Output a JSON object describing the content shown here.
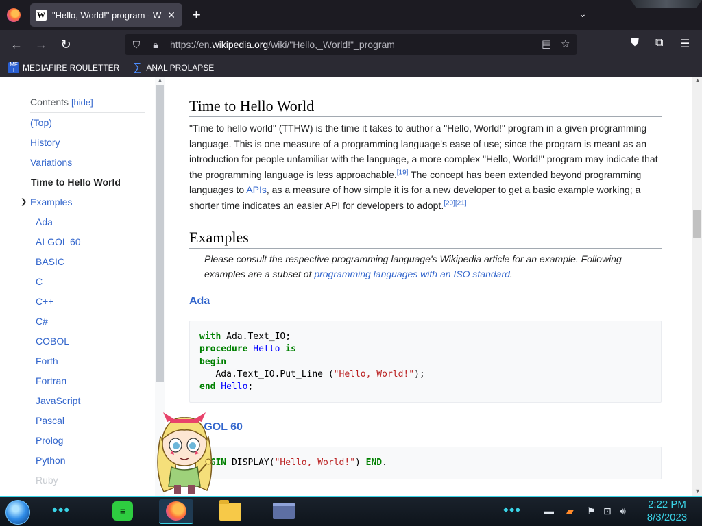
{
  "browser": {
    "tab_title": "\"Hello, World!\" program - Wikip",
    "tab_favicon": "W",
    "new_tab": "+",
    "url_prefix": "https://en.",
    "url_domain": "wikipedia.org",
    "url_path": "/wiki/\"Hello,_World!\"_program"
  },
  "bookmarks": [
    {
      "label": "MEDIAFIRE ROULETTER",
      "icon": "mediafire-icon"
    },
    {
      "label": "ANAL PROLAPSE",
      "icon": "sigma-icon"
    }
  ],
  "toc": {
    "heading": "Contents",
    "hide_label": "[hide]",
    "items": [
      {
        "label": "(Top)",
        "state": "link"
      },
      {
        "label": "History",
        "state": "link"
      },
      {
        "label": "Variations",
        "state": "link"
      },
      {
        "label": "Time to Hello World",
        "state": "active"
      },
      {
        "label": "Examples",
        "state": "link"
      },
      {
        "label": "Ada",
        "state": "link"
      },
      {
        "label": "ALGOL 60",
        "state": "link"
      },
      {
        "label": "BASIC",
        "state": "link"
      },
      {
        "label": "C",
        "state": "link"
      },
      {
        "label": "C++",
        "state": "link"
      },
      {
        "label": "C#",
        "state": "link"
      },
      {
        "label": "COBOL",
        "state": "link"
      },
      {
        "label": "Forth",
        "state": "link"
      },
      {
        "label": "Fortran",
        "state": "link"
      },
      {
        "label": "JavaScript",
        "state": "link"
      },
      {
        "label": "Pascal",
        "state": "link"
      },
      {
        "label": "Prolog",
        "state": "link"
      },
      {
        "label": "Python",
        "state": "link"
      },
      {
        "label": "Ruby",
        "state": "fade"
      }
    ]
  },
  "article": {
    "ttw_heading": "Time to Hello World",
    "ttw_para": {
      "p1": "\"Time to hello world\" (TTHW) is the time it takes to author a \"Hello, World!\" program in a given programming language. This is one measure of a programming language's ease of use; since the program is meant as an introduction for people unfamiliar with the language, a more complex \"Hello, World!\" program may indicate that the programming language is less approachable.",
      "ref1": "[19]",
      "p2": " The concept has been extended beyond programming languages to ",
      "link_apis": "APIs",
      "p3": ", as a measure of how simple it is for a new developer to get a basic example working; a shorter time indicates an easier API for developers to adopt.",
      "ref2": "[20][21]"
    },
    "examples_heading": "Examples",
    "hatnote": {
      "text": "Please consult the respective programming language's Wikipedia article for an example. Following examples are a subset of ",
      "link": "programming languages with an ISO standard",
      "end": "."
    },
    "ada_heading": "Ada",
    "ada_code": {
      "l1_kw": "with",
      "l1_rest": " Ada.Text_IO;",
      "l2_kw": "procedure",
      "l2_name": " Hello",
      "l2_kw2": " is",
      "l3_kw": "begin",
      "l4_a": "   Ada.Text_IO.Put_Line (",
      "l4_str": "\"Hello, World!\"",
      "l4_b": ");",
      "l5_kw": "end",
      "l5_name": " Hello",
      "l5_end": ";"
    },
    "algol_heading": "ALGOL 60",
    "algol_code": {
      "kw1": "BEGIN",
      "a": " DISPLAY(",
      "str": "\"Hello, World!\"",
      "b": ") ",
      "kw2": "END",
      "end": "."
    }
  },
  "taskbar": {
    "time": "2:22 PM",
    "date": "8/3/2023"
  }
}
